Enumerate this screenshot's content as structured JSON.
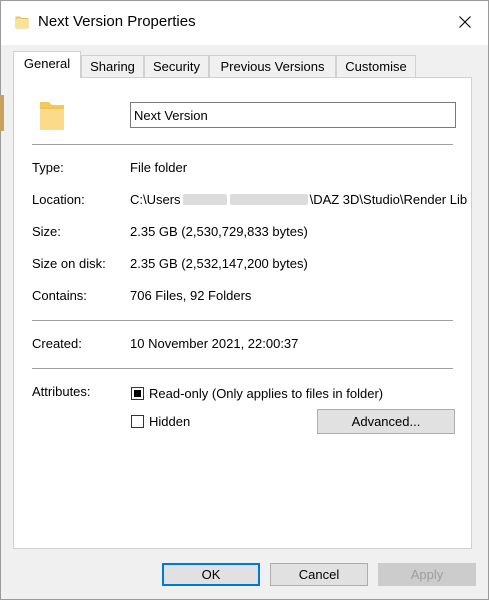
{
  "window": {
    "title": "Next Version Properties"
  },
  "tabs": [
    {
      "label": "General",
      "active": true
    },
    {
      "label": "Sharing",
      "active": false
    },
    {
      "label": "Security",
      "active": false
    },
    {
      "label": "Previous Versions",
      "active": false
    },
    {
      "label": "Customise",
      "active": false
    }
  ],
  "general": {
    "name": "Next Version",
    "type_label": "Type:",
    "type_value": "File folder",
    "location_label": "Location:",
    "location_prefix": "C:\\Users",
    "location_suffix": "DAZ 3D\\Studio\\Render Lib",
    "size_label": "Size:",
    "size_value": "2.35 GB (2,530,729,833 bytes)",
    "size_on_disk_label": "Size on disk:",
    "size_on_disk_value": "2.35 GB (2,532,147,200 bytes)",
    "contains_label": "Contains:",
    "contains_value": "706 Files, 92 Folders",
    "created_label": "Created:",
    "created_value": "10 November 2021, 22:00:37",
    "attributes_label": "Attributes:",
    "readonly_label": "Read-only (Only applies to files in folder)",
    "hidden_label": "Hidden",
    "advanced_label": "Advanced..."
  },
  "footer": {
    "ok_label": "OK",
    "cancel_label": "Cancel",
    "apply_label": "Apply"
  },
  "icons": {
    "title_icon": "folder-icon",
    "close": "close-icon",
    "folder_big": "folder-icon"
  },
  "colors": {
    "accent": "#0078d7",
    "folder": "#f8d775"
  }
}
